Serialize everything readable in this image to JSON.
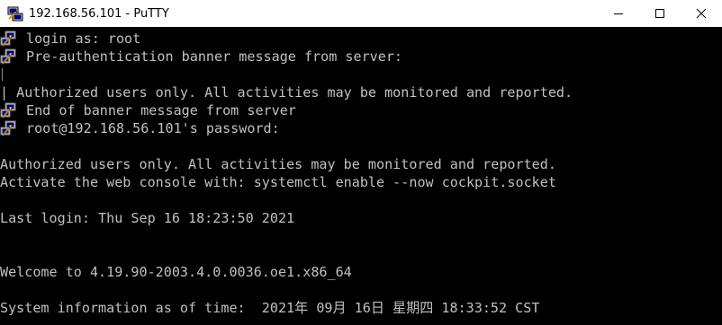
{
  "window": {
    "title": "192.168.56.101 - PuTTY"
  },
  "terminal": {
    "lines": [
      {
        "text": "login as: root",
        "icon": "putty-event-icon"
      },
      {
        "text": "Pre-authentication banner message from server:",
        "icon": "putty-event-icon"
      },
      {
        "text": "",
        "icon": "banner-bar"
      },
      {
        "text": "| Authorized users only. All activities may be monitored and reported.",
        "icon": ""
      },
      {
        "text": "End of banner message from server",
        "icon": "putty-event-icon"
      },
      {
        "text": "root@192.168.56.101's password:",
        "icon": "putty-event-icon"
      },
      {
        "text": "",
        "icon": ""
      },
      {
        "text": "Authorized users only. All activities may be monitored and reported.",
        "icon": ""
      },
      {
        "text": "Activate the web console with: systemctl enable --now cockpit.socket",
        "icon": ""
      },
      {
        "text": "",
        "icon": ""
      },
      {
        "text": "Last login: Thu Sep 16 18:23:50 2021",
        "icon": ""
      },
      {
        "text": "",
        "icon": ""
      },
      {
        "text": "",
        "icon": ""
      },
      {
        "text": "Welcome to 4.19.90-2003.4.0.0036.oe1.x86_64",
        "icon": ""
      },
      {
        "text": "",
        "icon": ""
      },
      {
        "text": "System information as of time:  2021年 09月 16日 星期四 18:33:52 CST",
        "icon": ""
      }
    ]
  },
  "colors": {
    "terminal_bg": "#000000",
    "terminal_fg": "#c0c0c0",
    "titlebar_bg": "#ffffff"
  }
}
